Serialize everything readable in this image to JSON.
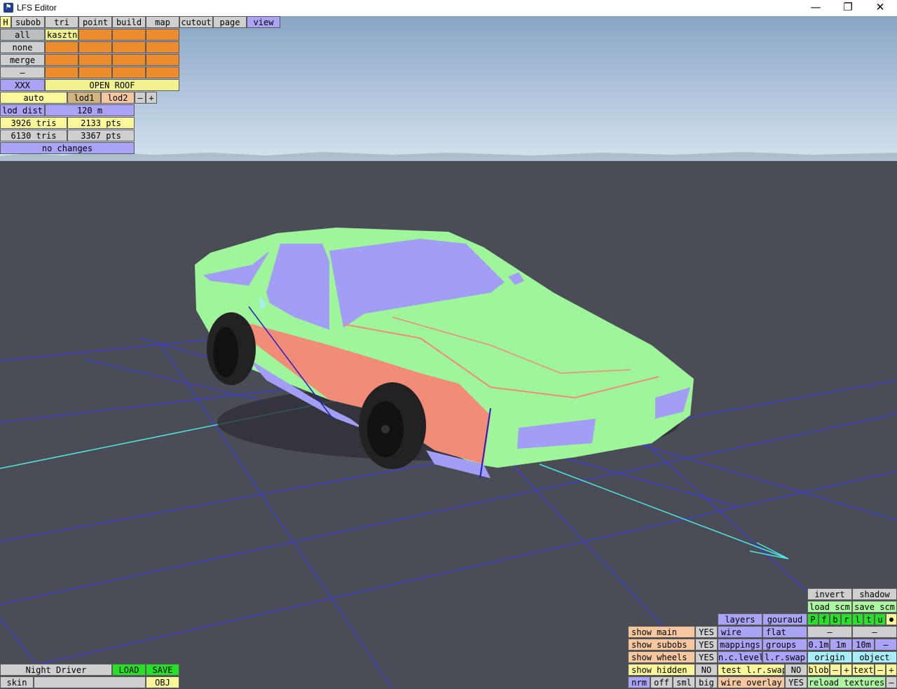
{
  "window": {
    "title": "LFS Editor",
    "minimize_glyph": "—",
    "restore_glyph": "❐",
    "close_glyph": "✕"
  },
  "menu": {
    "items": [
      "H",
      "subob",
      "tri",
      "point",
      "build",
      "map",
      "cutout",
      "page",
      "view"
    ],
    "active": "view"
  },
  "subobject_panel": {
    "rows": [
      "all",
      "none",
      "merge",
      "–"
    ],
    "selected_name": "kasztni",
    "xxx_label": "XXX",
    "subobject_name": "OPEN ROOF"
  },
  "lod": {
    "auto": "auto",
    "lod1": "lod1",
    "lod2": "lod2",
    "minus": "–",
    "plus": "+",
    "lod_dist_label": "lod dist",
    "lod_dist_value": "120 m",
    "tris1": "3926 tris",
    "pts1": "2133 pts",
    "tris2": "6130 tris",
    "pts2": "3367 pts",
    "status": "no changes"
  },
  "file_panel": {
    "name": "Night Driver",
    "load": "LOAD",
    "save": "SAVE",
    "skin": "skin",
    "skin_value": "",
    "obj": "OBJ"
  },
  "view_panel": {
    "invert": "invert",
    "shadow": "shadow",
    "load_scm": "load scm",
    "save_scm": "save scm",
    "letters": [
      "P",
      "f",
      "b",
      "r",
      "l",
      "t",
      "u"
    ],
    "layers": "layers",
    "gouraud": "gouraud",
    "wire": "wire",
    "flat": "flat",
    "mappings": "mappings",
    "groups": "groups",
    "show_main": "show main",
    "show_main_val": "YES",
    "show_subobs": "show subobs",
    "show_subobs_val": "YES",
    "show_wheels": "show wheels",
    "show_wheels_val": "YES",
    "show_hidden": "show hidden",
    "show_hidden_val": "NO",
    "nc_level": "n.c.level",
    "lr_swap": "l.r.swap",
    "test_lr_swap": "test l.r.swap",
    "test_lr_swap_val": "NO",
    "wire_overlay": "wire overlay",
    "wire_overlay_val": "YES",
    "dash": "–",
    "scale": [
      "0.1m",
      "1m",
      "10m"
    ],
    "origin": "origin",
    "object": "object",
    "blob": "blob",
    "text": "text",
    "minus": "–",
    "plus": "+",
    "reload_textures": "reload textures",
    "sizes": [
      "nrm",
      "off",
      "sml",
      "big"
    ]
  },
  "colors": {
    "sky_top": "#8fa9c8",
    "sky_bottom": "#cfe0ee",
    "ground": "#4a4c56",
    "car_body": "#9ef59a",
    "car_glass": "#a29ef5",
    "car_stripe": "#f08c78",
    "grid_line": "#3b3bdb",
    "axis_line": "#4fe6e6"
  }
}
